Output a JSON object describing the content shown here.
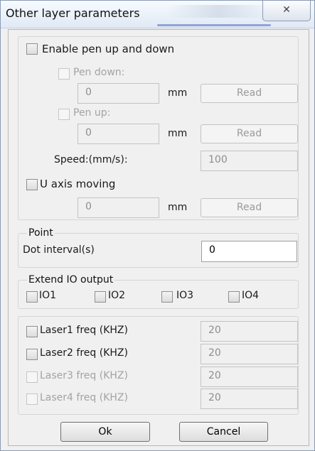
{
  "window": {
    "title": "Other layer parameters",
    "close_glyph": "✕"
  },
  "pen": {
    "enable_label": "Enable pen up and down",
    "down_label": "Pen down:",
    "down_value": "0",
    "down_unit": "mm",
    "down_read": "Read",
    "up_label": "Pen up:",
    "up_value": "0",
    "up_unit": "mm",
    "up_read": "Read",
    "speed_label": "Speed:(mm/s):",
    "speed_value": "100",
    "u_axis_label": "U axis moving",
    "u_value": "0",
    "u_unit": "mm",
    "u_read": "Read"
  },
  "point": {
    "legend": "Point",
    "dot_label": "Dot interval(s)",
    "dot_value": "0"
  },
  "io": {
    "legend": "Extend IO output",
    "items": [
      "IO1",
      "IO2",
      "IO3",
      "IO4"
    ]
  },
  "laser": {
    "items": [
      {
        "label": "Laser1 freq (KHZ)",
        "value": "20"
      },
      {
        "label": "Laser2 freq (KHZ)",
        "value": "20"
      },
      {
        "label": "Laser3 freq (KHZ)",
        "value": "20"
      },
      {
        "label": "Laser4 freq (KHZ)",
        "value": "20"
      }
    ]
  },
  "buttons": {
    "ok": "Ok",
    "cancel": "Cancel"
  },
  "colors": {
    "title_bar": "#dfe9f5",
    "dialog_bg": "#f0f0f0",
    "disabled_text": "#a3a3a3"
  }
}
